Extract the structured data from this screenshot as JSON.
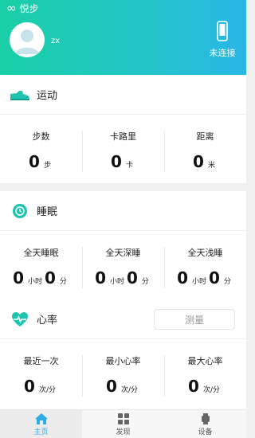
{
  "header": {
    "app_icon": "infinity-icon",
    "app_name": "悦步",
    "username": "zx",
    "device_icon": "phone-device-icon",
    "device_status": "未连接"
  },
  "sports": {
    "icon": "sneaker-icon",
    "title": "运动",
    "stats": [
      {
        "label": "步数",
        "value": "0",
        "unit": "步"
      },
      {
        "label": "卡路里",
        "value": "0",
        "unit": "卡"
      },
      {
        "label": "距离",
        "value": "0",
        "unit": "米"
      }
    ]
  },
  "sleep": {
    "icon": "moon-clock-icon",
    "title": "睡眠",
    "stats": [
      {
        "label": "全天睡眠",
        "hours": "0",
        "hour_unit": "小时",
        "minutes": "0",
        "minute_unit": "分"
      },
      {
        "label": "全天深睡",
        "hours": "0",
        "hour_unit": "小时",
        "minutes": "0",
        "minute_unit": "分"
      },
      {
        "label": "全天浅睡",
        "hours": "0",
        "hour_unit": "小时",
        "minutes": "0",
        "minute_unit": "分"
      }
    ]
  },
  "heart": {
    "icon": "heart-pulse-icon",
    "title": "心率",
    "measure_button": "测量",
    "stats": [
      {
        "label": "最近一次",
        "value": "0",
        "unit": "次/分"
      },
      {
        "label": "最小心率",
        "value": "0",
        "unit": "次/分"
      },
      {
        "label": "最大心率",
        "value": "0",
        "unit": "次/分"
      }
    ]
  },
  "tabbar": {
    "tabs": [
      {
        "label": "主页",
        "icon": "home-icon",
        "active": true
      },
      {
        "label": "发现",
        "icon": "grid-icon",
        "active": false
      },
      {
        "label": "设备",
        "icon": "watch-icon",
        "active": false
      }
    ]
  },
  "colors": {
    "header_gradient_start": "#19cfa6",
    "header_gradient_end": "#2ab6e6",
    "accent": "#1fc3b0",
    "active_tab": "#2aaee3"
  }
}
